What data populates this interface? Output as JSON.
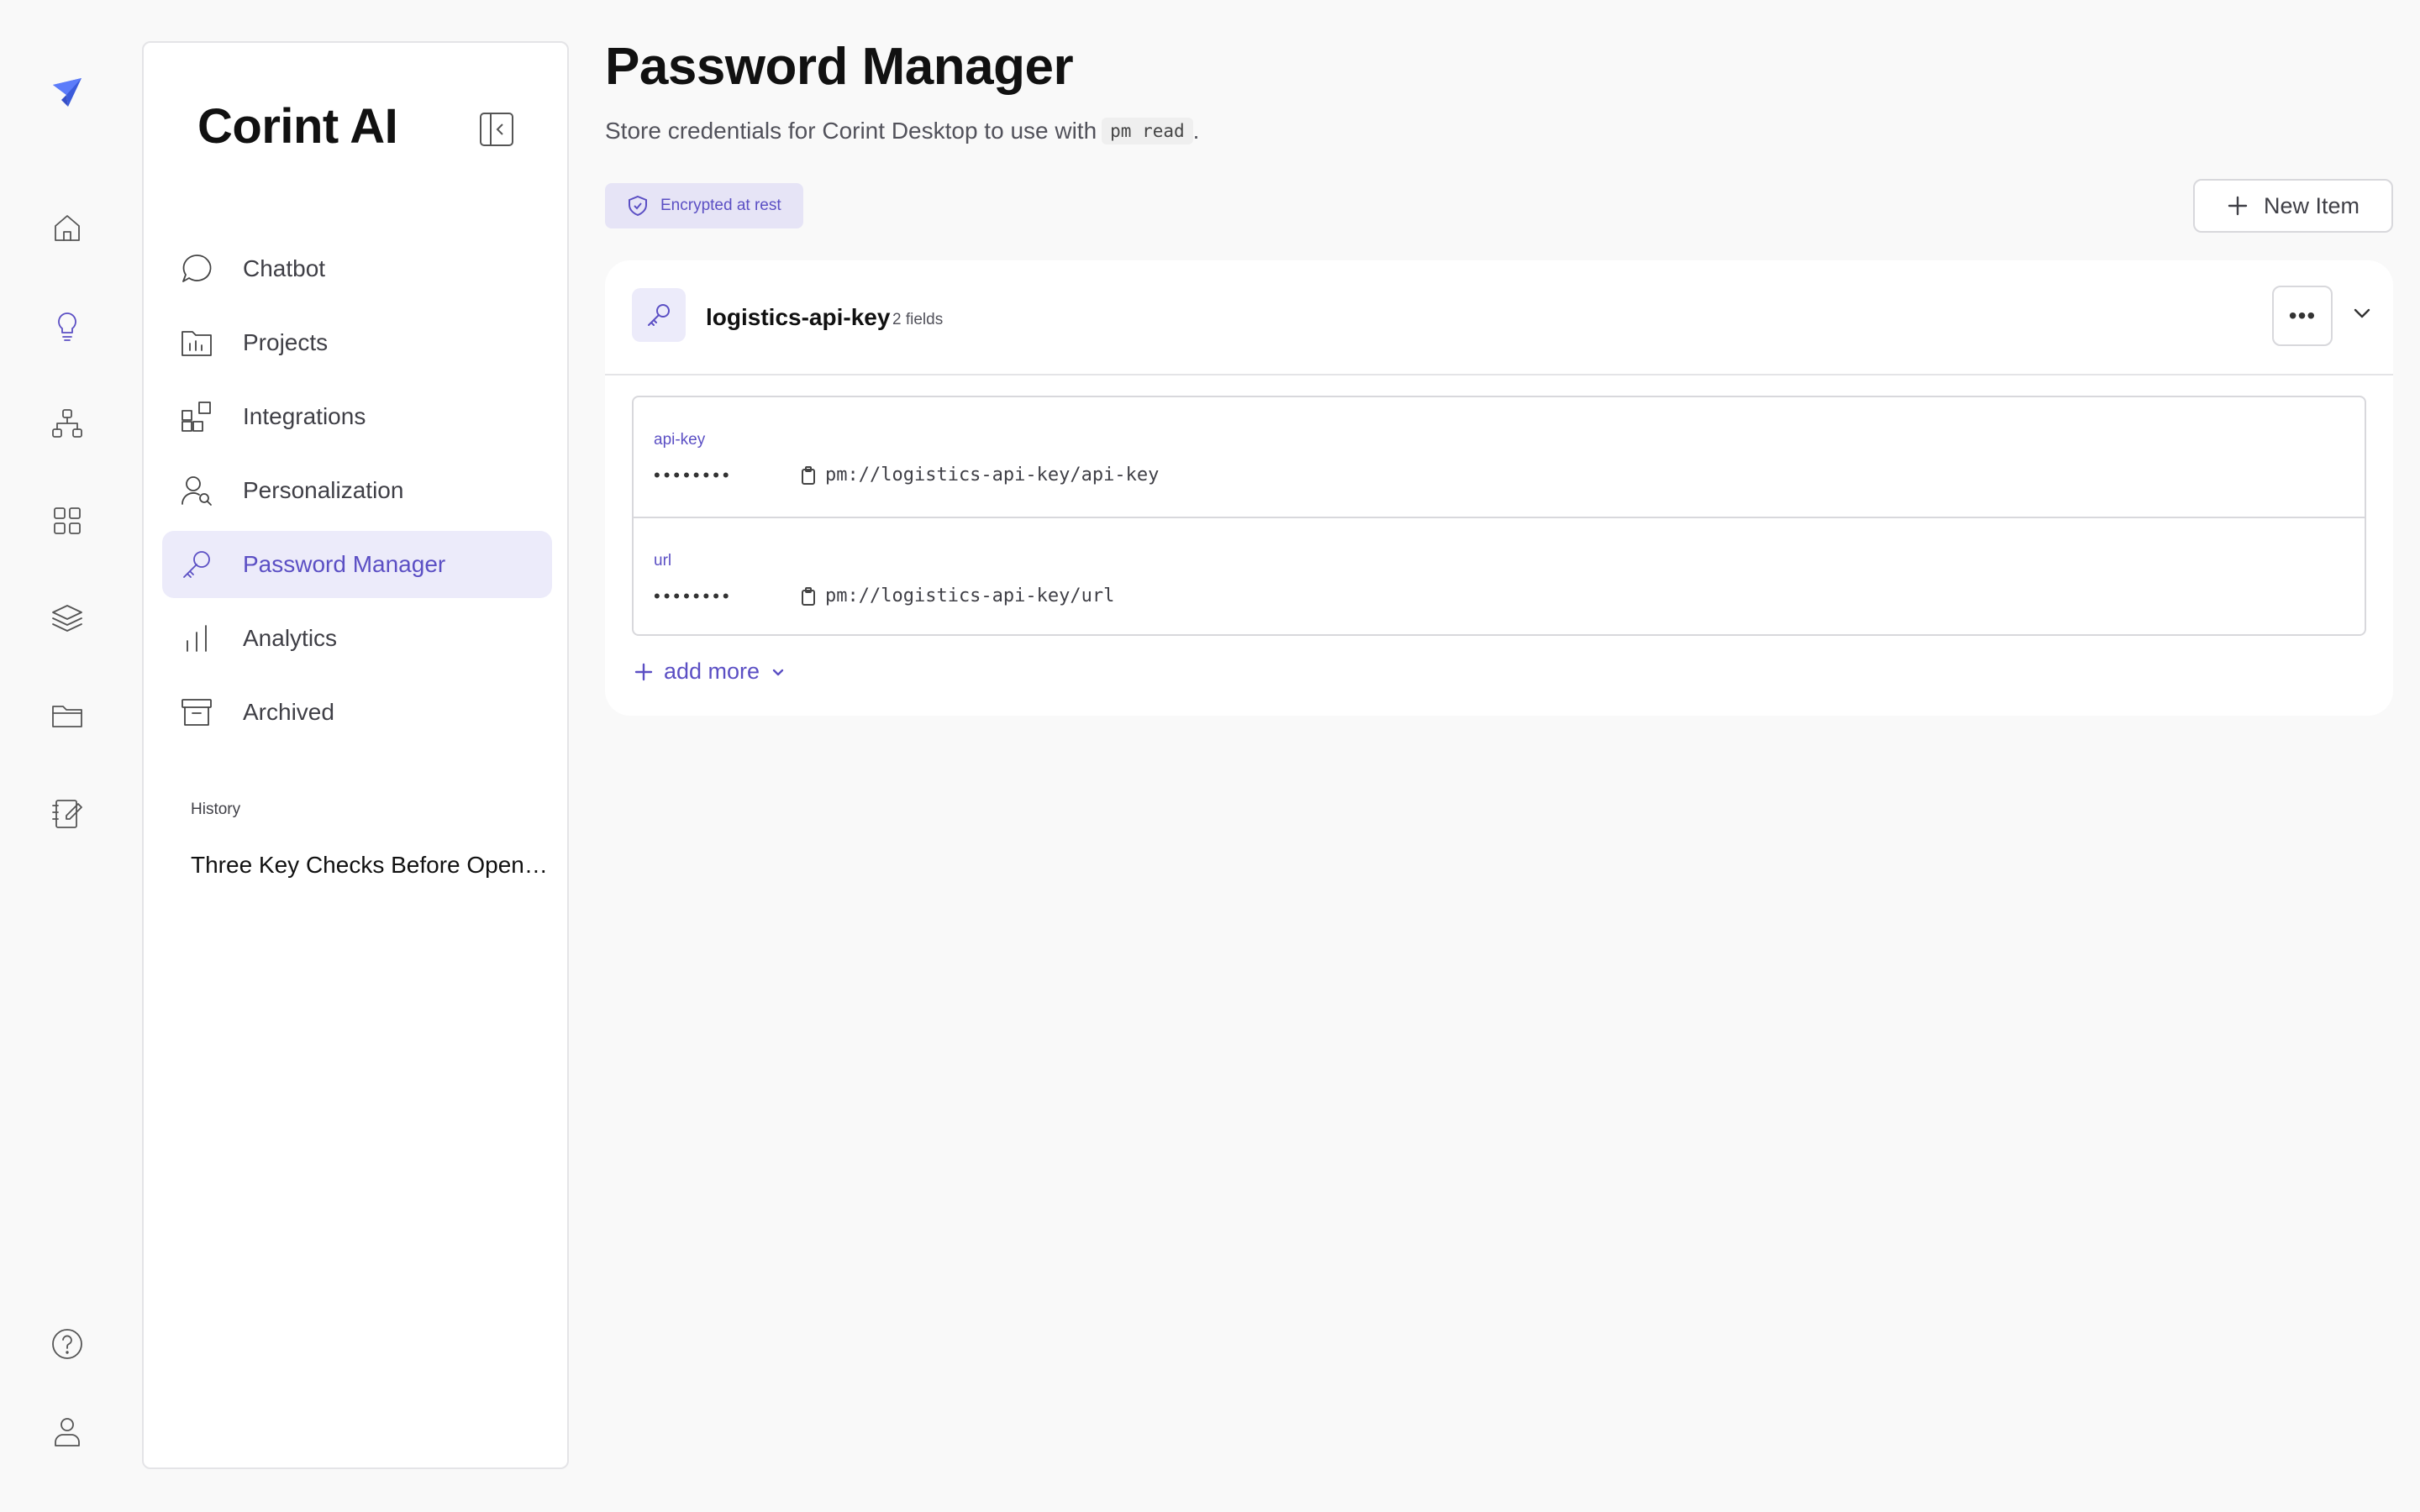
{
  "colors": {
    "accent": "#5b4fc4",
    "accent_bg": "#ecebfa",
    "page_bg": "#f9f9f9"
  },
  "rail": {
    "items": [
      {
        "icon": "logo-icon"
      },
      {
        "icon": "home-icon"
      },
      {
        "icon": "lightbulb-icon"
      },
      {
        "icon": "sitemap-icon"
      },
      {
        "icon": "grid-icon"
      },
      {
        "icon": "layers-icon"
      },
      {
        "icon": "folder-icon"
      },
      {
        "icon": "edit-note-icon"
      },
      {
        "icon": "help-icon"
      },
      {
        "icon": "user-icon"
      }
    ]
  },
  "sidebar": {
    "brand": "Corint AI",
    "items": [
      {
        "label": "Chatbot",
        "icon": "chat-bubble-icon"
      },
      {
        "label": "Projects",
        "icon": "projects-folder-icon"
      },
      {
        "label": "Integrations",
        "icon": "integrations-icon"
      },
      {
        "label": "Personalization",
        "icon": "person-search-icon"
      },
      {
        "label": "Password Manager",
        "icon": "key-icon",
        "active": true
      },
      {
        "label": "Analytics",
        "icon": "bar-chart-icon"
      },
      {
        "label": "Archived",
        "icon": "archive-icon"
      }
    ],
    "history_title": "History",
    "history": [
      "Three Key Checks Before Opening a Business Account"
    ]
  },
  "main": {
    "title": "Password Manager",
    "subtitle_prefix": "Store credentials for Corint Desktop to use with",
    "subtitle_code": "pm read",
    "subtitle_suffix": ".",
    "badge": "Encrypted at rest",
    "new_item_label": "New Item",
    "item": {
      "name": "logistics-api-key",
      "field_count": "2 fields",
      "more_label": "•••",
      "fields": [
        {
          "label": "api-key",
          "mask": "••••••••",
          "ref": "pm://logistics-api-key/api-key"
        },
        {
          "label": "url",
          "mask": "••••••••",
          "ref": "pm://logistics-api-key/url"
        }
      ],
      "add_more_label": "add more"
    }
  }
}
